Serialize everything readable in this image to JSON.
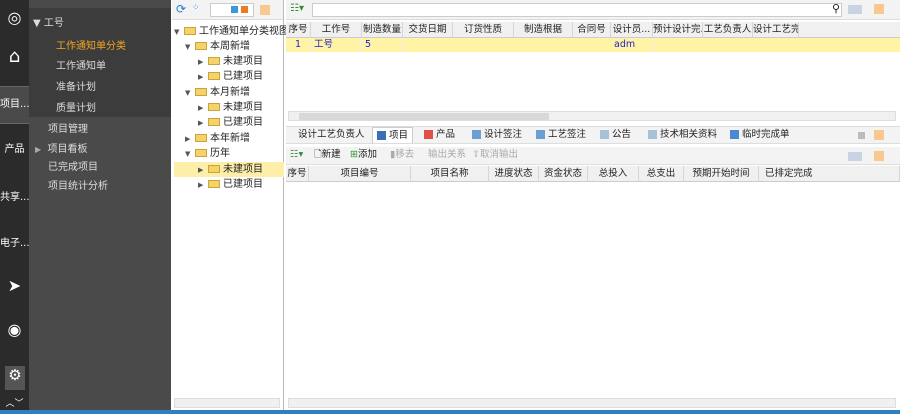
{
  "iconbar": {
    "items": [
      {
        "icon": "logo-icon"
      },
      {
        "icon": "home-icon"
      },
      {
        "label": "项目..."
      },
      {
        "label": "产品"
      },
      {
        "label": "共享..."
      },
      {
        "label": "电子..."
      },
      {
        "icon": "send-icon"
      },
      {
        "icon": "broadcast-icon"
      },
      {
        "icon": "gear-icon"
      }
    ]
  },
  "nav": {
    "group": "工号",
    "sub": [
      "工作通知单分类",
      "工作通知单",
      "准备计划",
      "质量计划"
    ],
    "items": [
      "项目管理",
      "项目看板",
      "已完成项目",
      "项目统计分析"
    ]
  },
  "tree": {
    "root": "工作通知单分类视图",
    "nodes": [
      "本周新增",
      "未建项目",
      "已建项目",
      "本月新增",
      "未建项目",
      "已建项目",
      "本年新增",
      "历年",
      "未建项目",
      "已建项目"
    ]
  },
  "top_grid": {
    "search_value": "",
    "columns": [
      "序号",
      "工作号",
      "制造数量",
      "交货日期",
      "订货性质",
      "制造根据",
      "合同号",
      "设计员...",
      "预计设计完...",
      "工艺负责人",
      "设计工艺完..."
    ],
    "rows": [
      [
        "1",
        "工号",
        "5",
        "",
        "",
        "",
        "",
        "adm",
        "",
        "",
        ""
      ]
    ]
  },
  "tabs": [
    "设计工艺负责人",
    "项目",
    "产品",
    "设计签注",
    "工艺签注",
    "公告",
    "技术相关资料",
    "临时完成单"
  ],
  "toolbar": {
    "new": "新建",
    "add": "添加",
    "remove": "移去",
    "export_rel": "输出关系",
    "cancel_export": "取消输出"
  },
  "bottom_grid": {
    "columns": [
      "序号",
      "项目编号",
      "项目名称",
      "进度状态",
      "资金状态",
      "总投入",
      "总支出",
      "预期开始时间",
      "已排定完成"
    ]
  },
  "colors": {
    "accent": "#f5a623",
    "selected_row": "#fff3a6",
    "status_bar": "#2f7fc1"
  }
}
